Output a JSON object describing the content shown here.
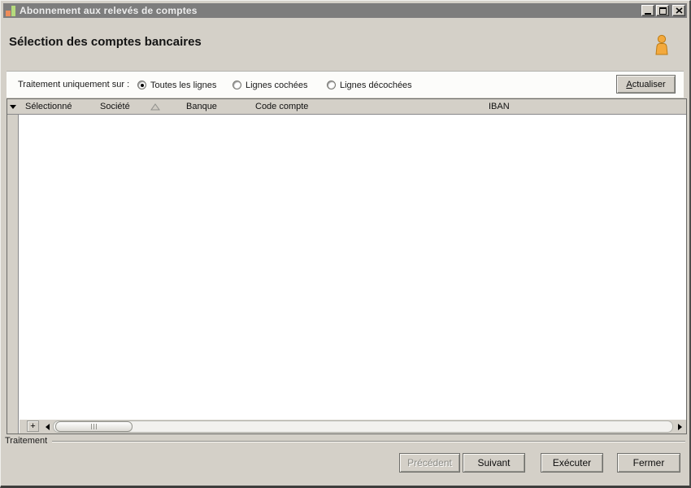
{
  "window": {
    "title": "Abonnement aux relevés de comptes",
    "icons": {
      "app": "bar-chart-icon",
      "minimize": "minimize-icon",
      "maximize": "maximize-icon",
      "close": "close-icon"
    }
  },
  "header": {
    "title": "Sélection des comptes bancaires",
    "icon": "person-icon"
  },
  "toolbar": {
    "filter_label": "Traitement uniquement sur :",
    "radios": [
      {
        "label": "Toutes les lignes",
        "checked": true
      },
      {
        "label": "Lignes cochées",
        "checked": false
      },
      {
        "label": "Lignes décochées",
        "checked": false
      }
    ],
    "refresh_button": {
      "key": "A",
      "rest": "ctualiser",
      "label": "Actualiser"
    }
  },
  "grid": {
    "columns": [
      {
        "label": "Sélectionné"
      },
      {
        "label": "Société",
        "sorted": "asc"
      },
      {
        "label": "Banque"
      },
      {
        "label": "Code compte"
      },
      {
        "label": "IBAN"
      }
    ],
    "rows": [],
    "add_row_button": "+"
  },
  "statusbar": {
    "group_label": "Traitement"
  },
  "footer": {
    "buttons": [
      {
        "label": "Précédent",
        "enabled": false
      },
      {
        "label": "Suivant",
        "enabled": true
      },
      {
        "label": "Exécuter",
        "enabled": true
      },
      {
        "label": "Fermer",
        "enabled": true
      }
    ]
  },
  "colors": {
    "titlebar": "#7d7d7d",
    "chrome": "#d4d0c8",
    "panel_white": "#fcfcfa",
    "person_orange": "#f3a93d",
    "icon_orange": "#ee8c5a",
    "icon_green": "#b5da7c"
  }
}
